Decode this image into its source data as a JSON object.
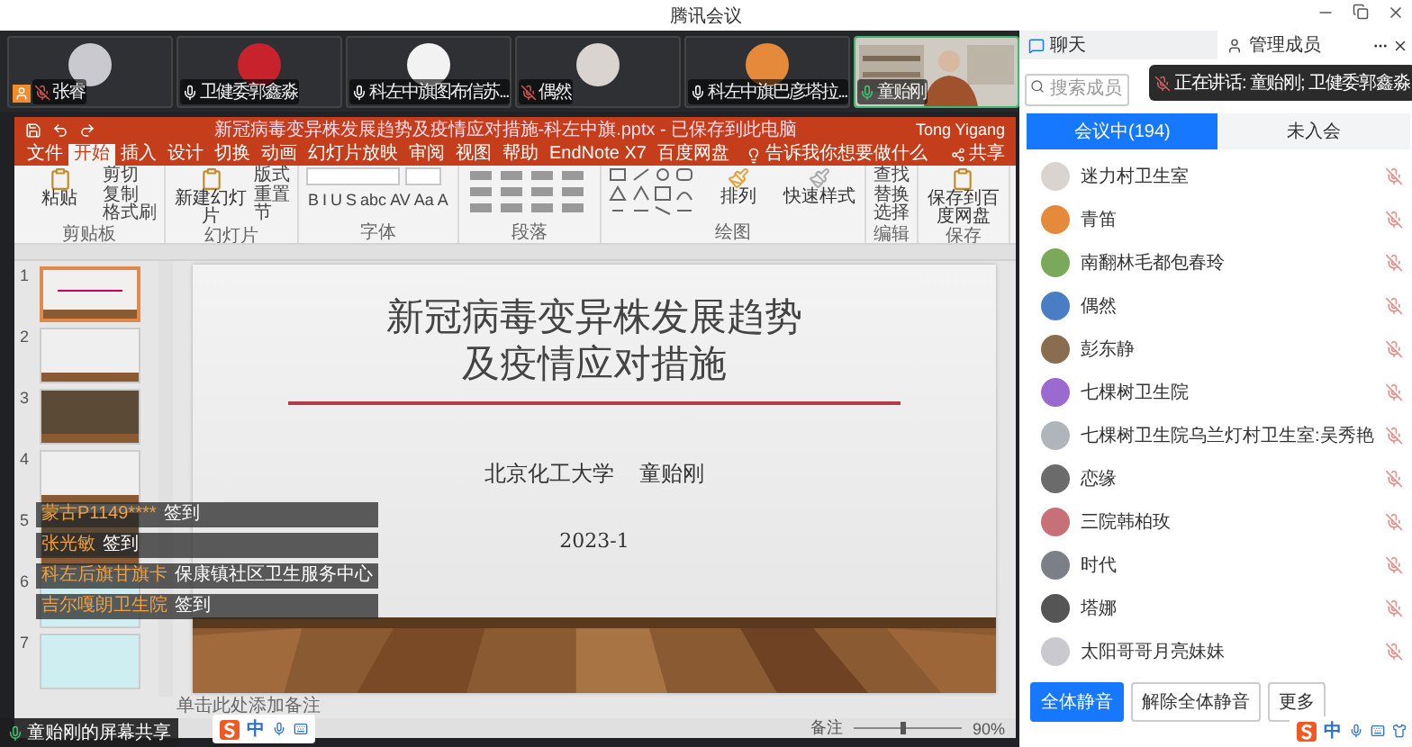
{
  "app_title": "腾讯会议",
  "video_tiles": [
    {
      "name": "张睿",
      "muted": true,
      "speaking": false,
      "host": true,
      "kind": "avatar"
    },
    {
      "name": "卫健委郭鑫淼",
      "muted": false,
      "speaking": false,
      "host": false,
      "kind": "avatar"
    },
    {
      "name": "科左中旗图布信苏...",
      "muted": false,
      "speaking": false,
      "host": false,
      "kind": "avatar"
    },
    {
      "name": "偶然",
      "muted": true,
      "speaking": false,
      "host": false,
      "kind": "avatar"
    },
    {
      "name": "科左中旗巴彦塔拉...",
      "muted": false,
      "speaking": false,
      "host": false,
      "kind": "avatar"
    },
    {
      "name": "童贻刚",
      "muted": false,
      "speaking": true,
      "host": false,
      "kind": "camera"
    }
  ],
  "ppt": {
    "file_title": "新冠病毒变异株发展趋势及疫情应对措施-科左中旗.pptx - 已保存到此电脑",
    "user": "Tong Yigang",
    "tabs": [
      {
        "label": "文件",
        "selected": false
      },
      {
        "label": "开始",
        "selected": true
      },
      {
        "label": "插入",
        "selected": false
      },
      {
        "label": "设计",
        "selected": false
      },
      {
        "label": "切换",
        "selected": false
      },
      {
        "label": "动画",
        "selected": false
      },
      {
        "label": "幻灯片放映",
        "selected": false
      },
      {
        "label": "审阅",
        "selected": false
      },
      {
        "label": "视图",
        "selected": false
      },
      {
        "label": "帮助",
        "selected": false
      },
      {
        "label": "EndNote X7",
        "selected": false
      },
      {
        "label": "百度网盘",
        "selected": false
      }
    ],
    "tell_me": "告诉我你想要做什么",
    "share": "共享",
    "ribbon": [
      {
        "label": "剪贴板",
        "kind": "stack",
        "items": [
          "粘贴",
          "剪切",
          "复制",
          "格式刷"
        ]
      },
      {
        "label": "幻灯片",
        "kind": "stack",
        "items": [
          "新建幻灯片",
          "版式",
          "重置",
          "节"
        ]
      },
      {
        "label": "字体",
        "kind": "letters",
        "items": [
          "B",
          "I",
          "U",
          "S",
          "abc",
          "AV",
          "Aa",
          "A"
        ]
      },
      {
        "label": "段落",
        "kind": "icons"
      },
      {
        "label": "绘图",
        "kind": "shapes",
        "items": [
          "排列",
          "快速样式"
        ]
      },
      {
        "label": "编辑",
        "kind": "list",
        "items": [
          "查找",
          "替换",
          "选择"
        ]
      },
      {
        "label": "保存",
        "kind": "stack",
        "items": [
          "保存到百度网盘"
        ]
      }
    ],
    "thumbnails": [
      {
        "number": "1",
        "kind": "title",
        "selected": true
      },
      {
        "number": "2",
        "kind": "text",
        "selected": false
      },
      {
        "number": "3",
        "selected": false
      },
      {
        "number": "4",
        "kind": "text",
        "selected": false
      },
      {
        "number": "5",
        "selected": false
      },
      {
        "number": "6",
        "kind": "table",
        "selected": false
      },
      {
        "number": "7",
        "kind": "table",
        "selected": false
      }
    ],
    "slide": {
      "title_lines": [
        "新冠病毒变异株发展趋势",
        "及疫情应对措施"
      ],
      "affiliation": "北京化工大学",
      "author": "童贻刚",
      "date": "2023-1"
    },
    "notes_placeholder": "单击此处添加备注",
    "status": {
      "notes": "备注",
      "level": 0.45,
      "zoom": "90%"
    }
  },
  "chat_overlay": [
    {
      "sender": "蒙古P1149****",
      "text": "签到"
    },
    {
      "sender": "张光敏",
      "text": "签到"
    },
    {
      "sender": "科左后旗甘旗卡",
      "text": "保康镇社区卫生服务中心"
    },
    {
      "sender": "吉尔嘎朗卫生院",
      "text": "签到"
    }
  ],
  "screen_share_label": "童贻刚的屏幕共享",
  "ime_toolbars": [
    {
      "label": "中"
    },
    {
      "label": "中"
    }
  ],
  "panel": {
    "tabs": [
      {
        "label": "聊天",
        "kind": "chat",
        "selected": false
      },
      {
        "label": "管理成员",
        "kind": "members",
        "selected": true
      }
    ],
    "search": {
      "placeholder": "搜索成员"
    },
    "speaking_toast": "正在讲话: 童贻刚; 卫健委郭鑫淼",
    "member_tabs": [
      {
        "label": "会议中(194)",
        "selected": true
      },
      {
        "label": "未入会",
        "selected": false
      }
    ],
    "members": [
      {
        "name": "迷力村卫生室",
        "muted": true
      },
      {
        "name": "青笛",
        "muted": true
      },
      {
        "name": "南翻林毛都包春玲",
        "muted": true
      },
      {
        "name": "偶然",
        "muted": true
      },
      {
        "name": "彭东静",
        "muted": true
      },
      {
        "name": "七棵树卫生院",
        "muted": true
      },
      {
        "name": "七棵树卫生院乌兰灯村卫生室:吴秀艳",
        "muted": true
      },
      {
        "name": "恋缘",
        "muted": true
      },
      {
        "name": "三院韩柏玫",
        "muted": true
      },
      {
        "name": "时代",
        "muted": true
      },
      {
        "name": "塔娜",
        "muted": true
      },
      {
        "name": "太阳哥哥月亮妹妹",
        "muted": true
      }
    ],
    "buttons": [
      {
        "label": "全体静音",
        "primary": true
      },
      {
        "label": "解除全体静音",
        "primary": false
      },
      {
        "label": "更多",
        "primary": false
      }
    ]
  }
}
